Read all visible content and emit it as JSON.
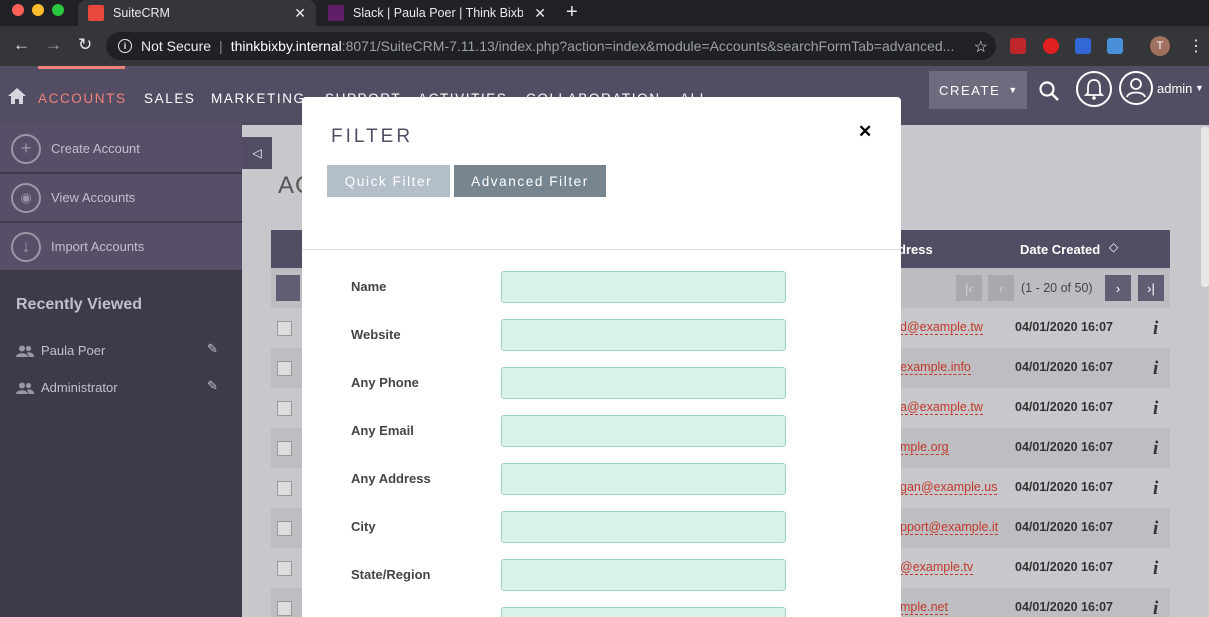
{
  "browser": {
    "tabs": [
      {
        "title": "SuiteCRM",
        "active": true
      },
      {
        "title": "Slack | Paula Poer | Think Bixby",
        "active": false
      }
    ],
    "security_label": "Not Secure",
    "url_host": "thinkbixby.internal",
    "url_path": ":8071/SuiteCRM-7.11.13/index.php?action=index&module=Accounts&searchFormTab=advanced...",
    "profile_initial": "T"
  },
  "nav": {
    "items": [
      "ACCOUNTS",
      "SALES",
      "MARKETING",
      "SUPPORT",
      "ACTIVITIES",
      "COLLABORATION",
      "ALL"
    ],
    "create_label": "CREATE",
    "user_label": "admin"
  },
  "sidebar": {
    "actions": [
      "Create Account",
      "View Accounts",
      "Import Accounts"
    ],
    "recent_title": "Recently Viewed",
    "recent": [
      "Paula Poer",
      "Administrator"
    ]
  },
  "list": {
    "title_fragment": "AC",
    "columns": {
      "address": "dress",
      "date_created": "Date Created"
    },
    "pagination": "(1 - 20 of 50)",
    "rows": [
      {
        "email": "d@example.tw",
        "date": "04/01/2020 16:07"
      },
      {
        "email": "example.info",
        "date": "04/01/2020 16:07"
      },
      {
        "email": "a@example.tw",
        "date": "04/01/2020 16:07"
      },
      {
        "email": "mple.org",
        "date": "04/01/2020 16:07"
      },
      {
        "email": "gan@example.us",
        "date": "04/01/2020 16:07"
      },
      {
        "email": "pport@example.it",
        "date": "04/01/2020 16:07"
      },
      {
        "email": "@example.tv",
        "date": "04/01/2020 16:07"
      },
      {
        "email": "mple.net",
        "date": "04/01/2020 16:07"
      }
    ]
  },
  "filter": {
    "title": "FILTER",
    "tabs": {
      "quick": "Quick Filter",
      "advanced": "Advanced Filter"
    },
    "fields": [
      "Name",
      "Website",
      "Any Phone",
      "Any Email",
      "Any Address",
      "City",
      "State/Region"
    ]
  },
  "colors": {
    "nav_bg": "#534d64",
    "accent": "#f08377",
    "input_bg": "#d8f2ea",
    "advanced_tab": "#778591",
    "quick_tab": "#b4bec9"
  }
}
